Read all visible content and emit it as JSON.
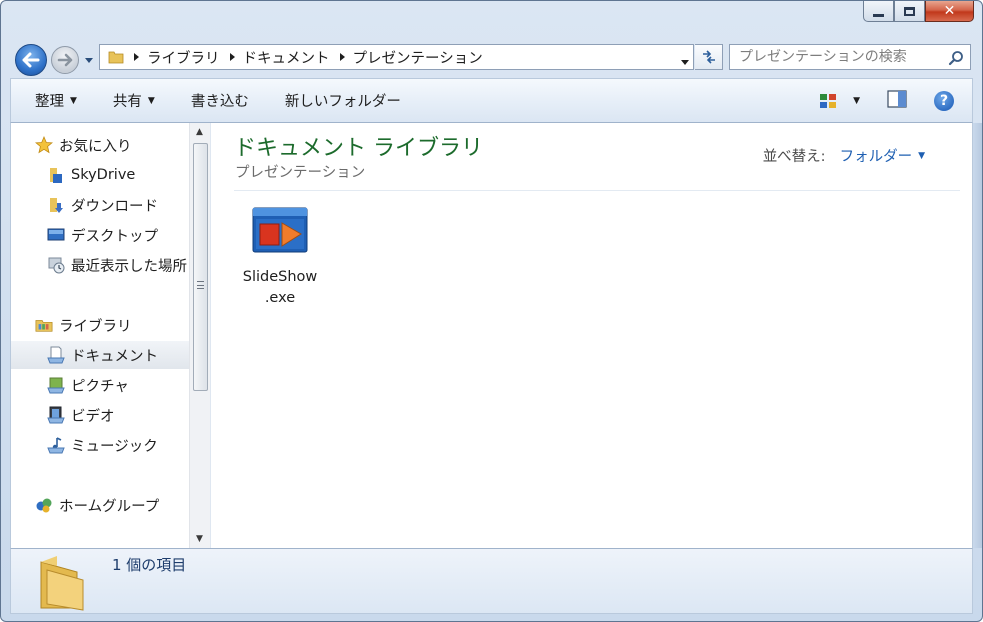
{
  "window": {
    "minimize_label": "",
    "maximize_label": "",
    "close_label": "✕"
  },
  "address": {
    "crumbs": [
      "ライブラリ",
      "ドキュメント",
      "プレゼンテーション"
    ]
  },
  "search": {
    "placeholder": "プレゼンテーションの検索"
  },
  "toolbar": {
    "organize": "整理",
    "share": "共有",
    "burn": "書き込む",
    "new_folder": "新しいフォルダー",
    "help": "?"
  },
  "nav": {
    "favorites": {
      "label": "お気に入り",
      "items": [
        "SkyDrive",
        "ダウンロード",
        "デスクトップ",
        "最近表示した場所"
      ]
    },
    "libraries": {
      "label": "ライブラリ",
      "items": [
        "ドキュメント",
        "ピクチャ",
        "ビデオ",
        "ミュージック"
      ]
    },
    "homegroup": "ホームグループ"
  },
  "content": {
    "title": "ドキュメント ライブラリ",
    "subtitle": "プレゼンテーション",
    "arrange_label": "並べ替え:",
    "arrange_value": "フォルダー",
    "files": [
      {
        "name_line1": "SlideShow",
        "name_line2": ".exe"
      }
    ]
  },
  "status": {
    "text": "1 個の項目"
  },
  "colors": {
    "accent_title": "#1c6b2c",
    "link_blue": "#1e5fb2",
    "window_frame": "#c9d9ec"
  }
}
